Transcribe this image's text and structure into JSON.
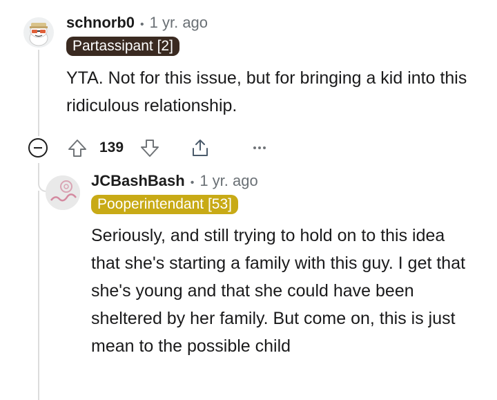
{
  "comment1": {
    "username": "schnorb0",
    "separator": "•",
    "time": "1 yr. ago",
    "flair": "Partassipant [2]",
    "flair_color": "#3a2a21",
    "body": "YTA. Not for this issue, but for bringing a kid into this ridiculous relationship.",
    "vote_count": "139",
    "icons": [
      "collapse-icon",
      "upvote-icon",
      "downvote-icon",
      "share-icon",
      "more-options-icon"
    ]
  },
  "comment2": {
    "username": "JCBashBash",
    "separator": "•",
    "time": "1 yr. ago",
    "flair": "Pooperintendant [53]",
    "flair_color": "#c8aa16",
    "body": "Seriously, and still trying to hold on to this idea that she's starting a family with this guy. I get that she's young and that she could have been sheltered by her family. But come on, this is just mean to the possible child"
  },
  "colors": {
    "thread_line": "#dcdcdc",
    "meta_text": "#6a7075"
  }
}
